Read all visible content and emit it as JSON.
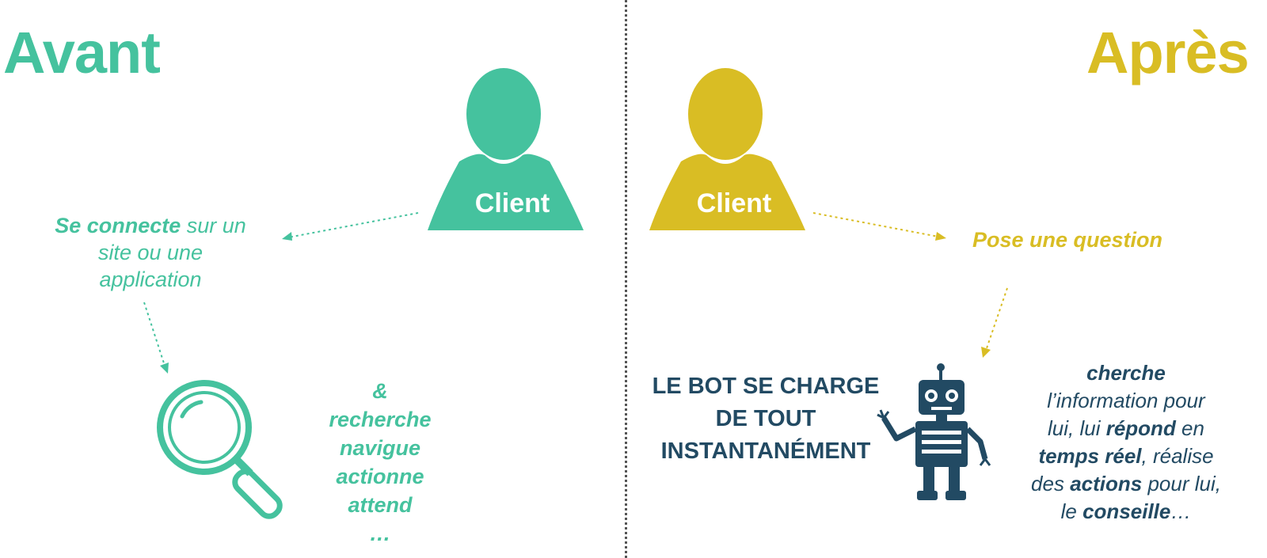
{
  "colors": {
    "before": "#45c29e",
    "after": "#d9bd24",
    "bot": "#224a63",
    "divider": "#555555"
  },
  "avant": {
    "title": "Avant",
    "client_label": "Client",
    "step1_bold": "Se connecte",
    "step1_rest_line1": " sur un",
    "step1_line2": "site ou une",
    "step1_line3": "application",
    "icon": "magnifier-icon",
    "actions": [
      "&",
      "recherche",
      "navigue",
      "actionne",
      "attend",
      "…"
    ]
  },
  "apres": {
    "title": "Après",
    "client_label": "Client",
    "question": "Pose une question",
    "bot_line1": "LE BOT SE CHARGE",
    "bot_line2": "DE TOUT",
    "bot_line3": "INSTANTANÉMENT",
    "icon": "robot-icon",
    "desc": {
      "w_cherche": "cherche",
      "t_information": "l’information pour",
      "t_lui1": "lui, lui ",
      "w_repond": "répond",
      "t_en": " en",
      "w_temps_reel": "temps réel",
      "t_realise": ", réalise",
      "t_des": "des ",
      "w_actions": "actions",
      "t_pour_lui": " pour lui,",
      "t_le": "le ",
      "w_conseille": "conseille",
      "t_ellipsis": "…"
    }
  }
}
